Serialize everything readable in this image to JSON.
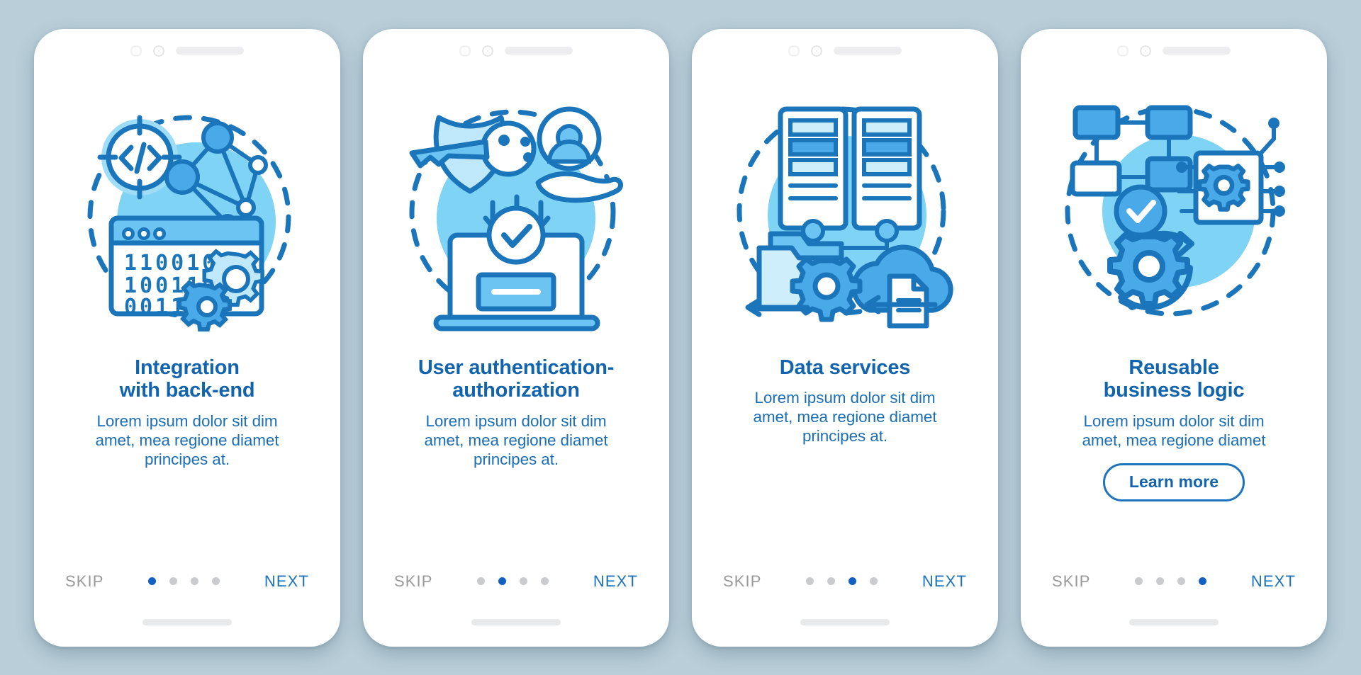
{
  "theme": {
    "page_background": "#b9ced9",
    "card_background": "#ffffff",
    "title_color": "#1264ae",
    "body_color": "#1c6fb5",
    "accent_blue": "#1260c4",
    "next_color": "#1c73bd",
    "skip_color": "#9a9a9a",
    "blob_color": "#7fd3f4",
    "stroke_color": "#1b75bb",
    "fill_light": "#cfeefb",
    "fill_mid": "#4aa9e8"
  },
  "common": {
    "skip_label": "SKIP",
    "next_label": "NEXT",
    "dot_count": 4,
    "notch": {
      "camera_icon": "camera-dot-icon",
      "sensor_icon": "sensor-dot-icon",
      "speaker_icon": "speaker-bar-icon"
    },
    "home_indicator": "home-indicator-bar"
  },
  "screens": [
    {
      "id": "integration-with-back-end",
      "illustration": "code-target-network-binary-gears-illustration",
      "title_lines": [
        "Integration",
        "with back-end"
      ],
      "title": "Integration with back-end",
      "description_lines": [
        "Lorem ipsum dolor sit dim",
        "amet, mea regione diamet",
        "principes at."
      ],
      "description": "Lorem ipsum dolor sit dim amet, mea regione diamet principes at.",
      "cta": null,
      "active_dot": 1,
      "binary_rows": [
        "110010",
        "100110",
        "00111"
      ]
    },
    {
      "id": "user-authentication-authorization",
      "illustration": "key-shield-avatar-laptop-check-illustration",
      "title_lines": [
        "User authentication-",
        "authorization"
      ],
      "title": "User authentication-authorization",
      "description_lines": [
        "Lorem ipsum dolor sit dim",
        "amet, mea regione diamet",
        "principes at."
      ],
      "description": "Lorem ipsum dolor sit dim amet, mea regione diamet principes at.",
      "cta": null,
      "active_dot": 2
    },
    {
      "id": "data-services",
      "illustration": "server-rack-folder-cloud-gear-illustration",
      "title_lines": [
        "Data services"
      ],
      "title": "Data services",
      "description_lines": [
        "Lorem ipsum dolor sit dim",
        "amet, mea regione diamet",
        "principes at."
      ],
      "description": "Lorem ipsum dolor sit dim amet, mea regione diamet principes at.",
      "cta": null,
      "active_dot": 3
    },
    {
      "id": "reusable-business-logic",
      "illustration": "flowchart-chip-gear-refresh-illustration",
      "title_lines": [
        "Reusable",
        "business logic"
      ],
      "title": "Reusable business logic",
      "description_lines": [
        "Lorem ipsum dolor sit dim",
        "amet, mea regione diamet"
      ],
      "description": "Lorem ipsum dolor sit dim amet, mea regione diamet",
      "cta": "Learn more",
      "active_dot": 4
    }
  ]
}
